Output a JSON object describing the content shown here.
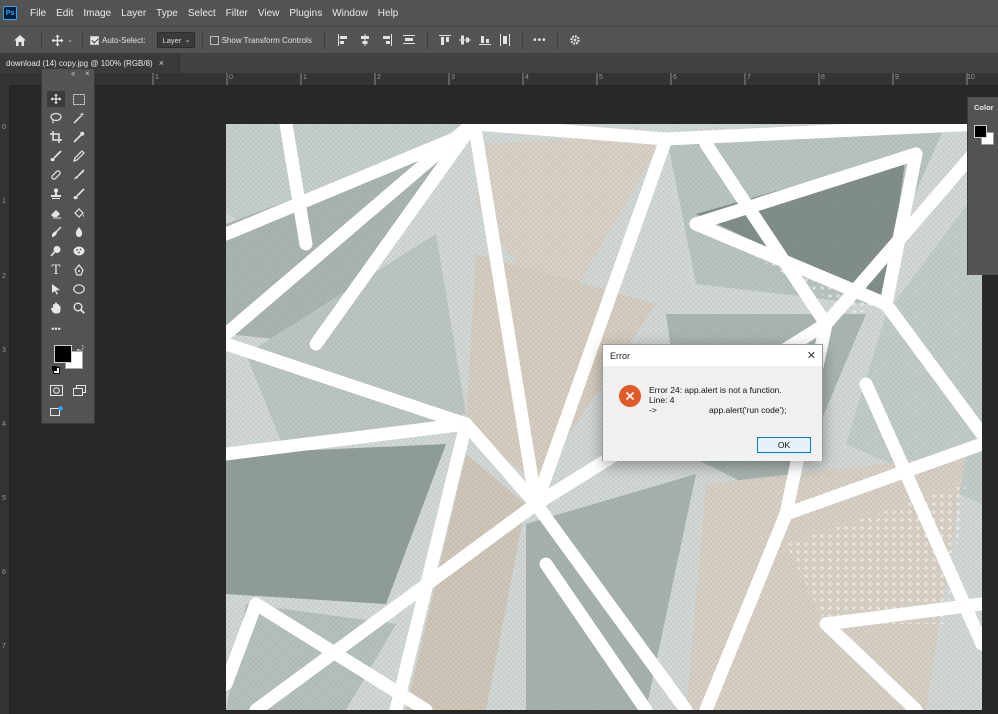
{
  "menu": {
    "app_badge": "Ps",
    "items": [
      "File",
      "Edit",
      "Image",
      "Layer",
      "Type",
      "Select",
      "Filter",
      "View",
      "Plugins",
      "Window",
      "Help"
    ]
  },
  "options_bar": {
    "auto_select_label": "Auto-Select:",
    "auto_select_checked": true,
    "layer_select_value": "Layer",
    "show_transform_label": "Show Transform Controls",
    "show_transform_checked": false
  },
  "document_tab": {
    "title": "download (14) copy.jpg @ 100% (RGB/8)",
    "close_glyph": "×"
  },
  "rulers": {
    "horizontal": [
      "1",
      "0",
      "1",
      "2",
      "3",
      "4",
      "5",
      "6",
      "7",
      "8",
      "9",
      "10"
    ],
    "vertical": [
      "0",
      "1",
      "2",
      "3",
      "4",
      "5",
      "6",
      "7"
    ]
  },
  "toolbar": {
    "collapse_glyph": "«",
    "close_glyph": "×",
    "more_glyph": "•••"
  },
  "color_panel": {
    "title": "Color",
    "foreground": "#000000",
    "background": "#ffffff"
  },
  "error_dialog": {
    "title": "Error",
    "close_glyph": "✕",
    "message_line1": "Error 24: app.alert is not a function.",
    "message_line2": "Line: 4",
    "message_arrow": "->",
    "message_code": "app.alert('run code');",
    "ok_label": "OK"
  },
  "colors": {
    "ui_panel": "#535353",
    "workspace": "#282828",
    "error_icon": "#e05a2a",
    "dialog_button_border": "#0078d7"
  }
}
